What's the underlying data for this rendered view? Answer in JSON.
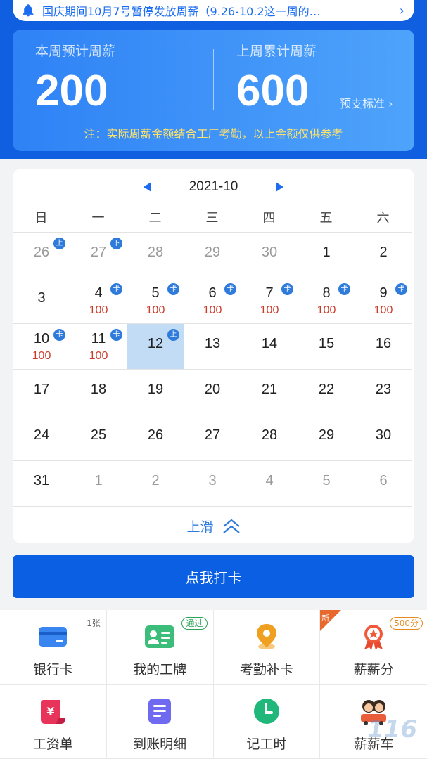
{
  "notice": {
    "icon": "bell-icon",
    "text": "国庆期间10月7号暂停发放周薪（9.26-10.2这一周的…"
  },
  "wage_card": {
    "this_week_label": "本周预计周薪",
    "this_week_value": "200",
    "last_week_label": "上周累计周薪",
    "last_week_value": "600",
    "advance_standard_link": "预支标准",
    "note": "注：实际周薪金额结合工厂考勤，以上金额仅供参考"
  },
  "calendar": {
    "month": "2021-10",
    "weekdays": [
      "日",
      "一",
      "二",
      "三",
      "四",
      "五",
      "六"
    ],
    "days": [
      {
        "day": "26",
        "muted": true,
        "badge": "上"
      },
      {
        "day": "27",
        "muted": true,
        "badge": "下"
      },
      {
        "day": "28",
        "muted": true
      },
      {
        "day": "29",
        "muted": true
      },
      {
        "day": "30",
        "muted": true
      },
      {
        "day": "1"
      },
      {
        "day": "2"
      },
      {
        "day": "3"
      },
      {
        "day": "4",
        "badge": "卡",
        "amount": "100"
      },
      {
        "day": "5",
        "badge": "卡",
        "amount": "100"
      },
      {
        "day": "6",
        "badge": "卡",
        "amount": "100"
      },
      {
        "day": "7",
        "badge": "卡",
        "amount": "100"
      },
      {
        "day": "8",
        "badge": "卡",
        "amount": "100"
      },
      {
        "day": "9",
        "badge": "卡",
        "amount": "100"
      },
      {
        "day": "10",
        "badge": "卡",
        "amount": "100"
      },
      {
        "day": "11",
        "badge": "卡",
        "amount": "100"
      },
      {
        "day": "12",
        "badge": "上",
        "selected": true
      },
      {
        "day": "13"
      },
      {
        "day": "14"
      },
      {
        "day": "15"
      },
      {
        "day": "16"
      },
      {
        "day": "17"
      },
      {
        "day": "18"
      },
      {
        "day": "19"
      },
      {
        "day": "20"
      },
      {
        "day": "21"
      },
      {
        "day": "22"
      },
      {
        "day": "23"
      },
      {
        "day": "24"
      },
      {
        "day": "25"
      },
      {
        "day": "26"
      },
      {
        "day": "27"
      },
      {
        "day": "28"
      },
      {
        "day": "29"
      },
      {
        "day": "30"
      },
      {
        "day": "31"
      },
      {
        "day": "1",
        "muted": true
      },
      {
        "day": "2",
        "muted": true
      },
      {
        "day": "3",
        "muted": true
      },
      {
        "day": "4",
        "muted": true
      },
      {
        "day": "5",
        "muted": true
      },
      {
        "day": "6",
        "muted": true
      }
    ],
    "slide_up_label": "上滑"
  },
  "punch_button": "点我打卡",
  "menu": [
    {
      "label": "银行卡",
      "icon": "bank-card-icon",
      "tag": "1张",
      "tag_type": "count"
    },
    {
      "label": "我的工牌",
      "icon": "work-badge-icon",
      "tag": "通过",
      "tag_type": "pass"
    },
    {
      "label": "考勤补卡",
      "icon": "location-pin-icon"
    },
    {
      "label": "薪薪分",
      "icon": "medal-icon",
      "tag": "500分",
      "tag_type": "score",
      "corner": "新"
    },
    {
      "label": "工资单",
      "icon": "payslip-icon"
    },
    {
      "label": "到账明细",
      "icon": "document-list-icon"
    },
    {
      "label": "记工时",
      "icon": "clock-icon"
    },
    {
      "label": "薪薪车",
      "icon": "car-avatar-icon"
    }
  ],
  "watermark": "116",
  "colors": {
    "primary": "#0a5fe3",
    "amount_red": "#cc3a2a",
    "note_yellow": "#ffe36b"
  }
}
